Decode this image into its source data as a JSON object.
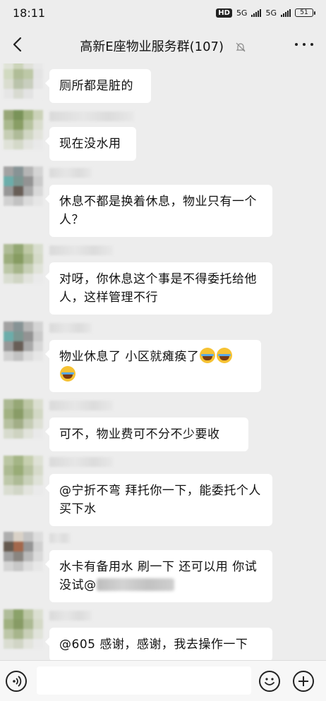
{
  "status_bar": {
    "time": "18:11",
    "hd_label": "HD",
    "net1": "5G",
    "net2": "5G",
    "battery": "51"
  },
  "header": {
    "title": "高新E座物业服务群(107)",
    "back_icon": "chevron-left-icon",
    "mute_icon": "bell-off-icon",
    "more_icon": "more-dots-icon"
  },
  "messages": [
    {
      "text": "厕所都是脏的"
    },
    {
      "text": "现在没水用"
    },
    {
      "text": "休息不都是换着休息，物业只有一个人？"
    },
    {
      "text": "对呀，你休息这个事是不得委托给他人，这样管理不行"
    },
    {
      "text": "物业休息了 小区就瘫痪了"
    },
    {
      "text": "可不，物业费可不分不少要收"
    },
    {
      "text": "@宁折不弯  拜托你一下，能委托个人买下水"
    },
    {
      "text": "水卡有备用水 刷一下 还可以用  你试没试@"
    },
    {
      "text": "@605 感谢，感谢，我去操作一下"
    }
  ],
  "input_bar": {
    "voice_icon": "voice-icon",
    "emoji_icon": "smile-icon",
    "add_icon": "plus-circle-icon",
    "input_value": ""
  },
  "colors": {
    "background": "#ededed",
    "bubble": "#ffffff",
    "input_bar": "#f7f7f7"
  }
}
